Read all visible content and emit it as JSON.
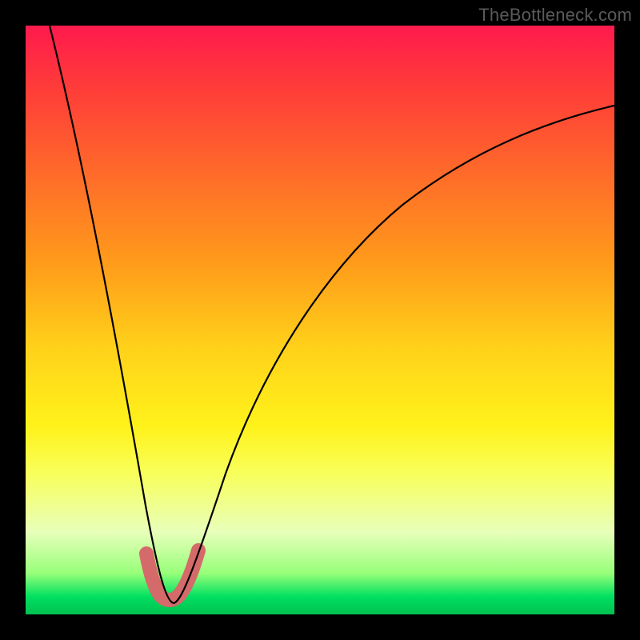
{
  "watermark": "TheBottleneck.com",
  "chart_data": {
    "type": "line",
    "title": "",
    "xlabel": "",
    "ylabel": "",
    "xlim": [
      0,
      100
    ],
    "ylim": [
      0,
      100
    ],
    "series": [
      {
        "name": "bottleneck-curve",
        "color": "#000000",
        "x": [
          5,
          10,
          15,
          20,
          23,
          25,
          27,
          30,
          35,
          40,
          45,
          50,
          55,
          60,
          65,
          70,
          75,
          80,
          85,
          90,
          95,
          100
        ],
        "values": [
          100,
          70,
          40,
          15,
          5,
          2,
          5,
          13,
          27,
          38,
          46,
          53,
          58,
          63,
          67,
          70,
          73,
          75,
          77,
          79,
          80,
          81
        ]
      },
      {
        "name": "highlight-band",
        "color": "#d96b6b",
        "x": [
          21,
          23,
          25,
          27,
          29
        ],
        "values": [
          10,
          4,
          2,
          4,
          10
        ]
      }
    ],
    "minimum_at_x": 25,
    "minimum_value": 2
  }
}
